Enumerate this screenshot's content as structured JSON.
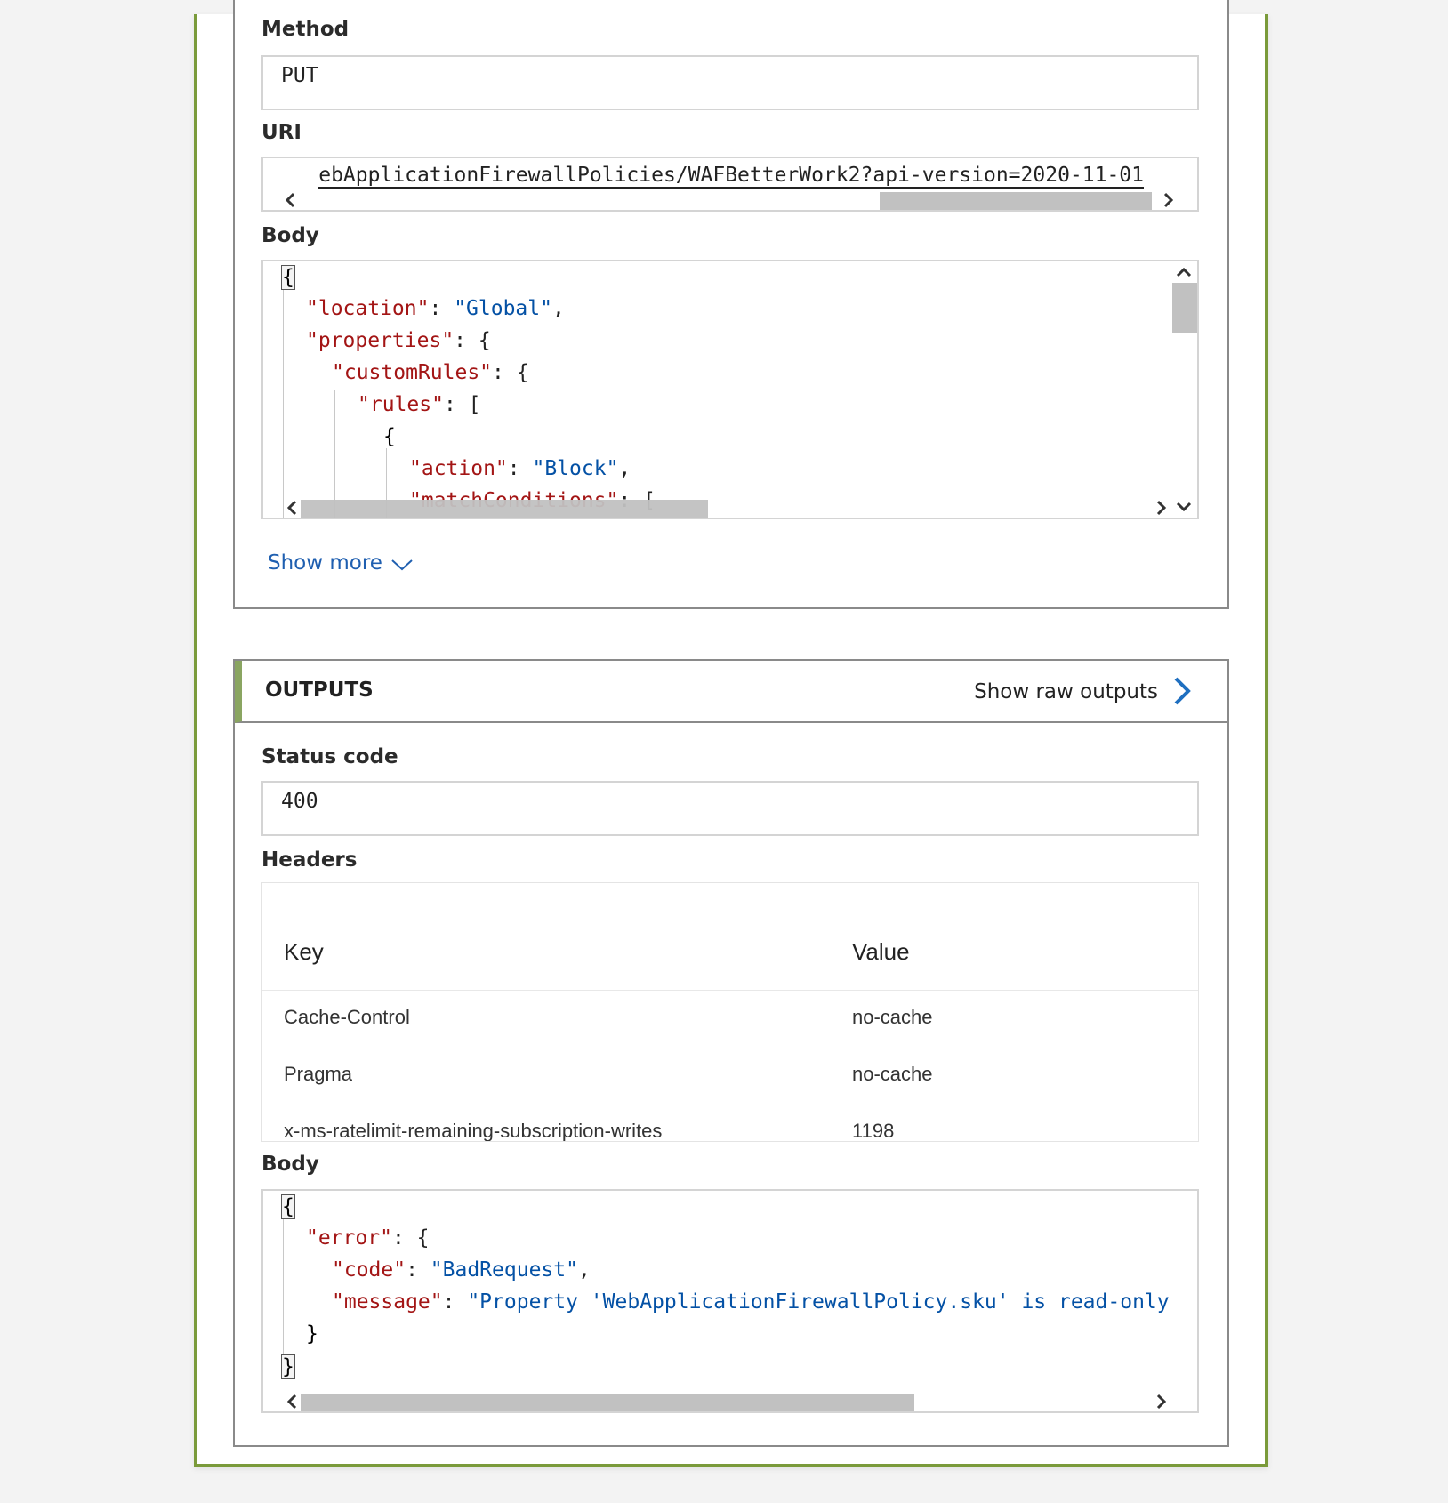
{
  "inputs": {
    "method": {
      "label": "Method",
      "value": "PUT"
    },
    "uri": {
      "label": "URI",
      "value": "ebApplicationFirewallPolicies/WAFBetterWork2?api-version=2020-11-01"
    },
    "body": {
      "label": "Body",
      "lines": [
        {
          "k": "",
          "v": "{"
        },
        {
          "k": "\"location\"",
          "sep": ": ",
          "v": "\"Global\"",
          "end": ","
        },
        {
          "k": "\"properties\"",
          "sep": ": ",
          "v": "",
          "end": "{"
        },
        {
          "k": "\"customRules\"",
          "sep": ": ",
          "v": "",
          "end": "{"
        },
        {
          "k": "\"rules\"",
          "sep": ": ",
          "v": "",
          "end": "["
        },
        {
          "k": "",
          "v": "{"
        },
        {
          "k": "\"action\"",
          "sep": ": ",
          "v": "\"Block\"",
          "end": ","
        },
        {
          "k": "\"matchConditions\"",
          "sep": ": ",
          "v": "",
          "end": "["
        }
      ]
    },
    "show_more": "Show more"
  },
  "outputs": {
    "title": "OUTPUTS",
    "show_raw": "Show raw outputs",
    "status": {
      "label": "Status code",
      "value": "400"
    },
    "headers": {
      "label": "Headers",
      "col_key": "Key",
      "col_value": "Value",
      "rows": [
        {
          "key": "Cache-Control",
          "value": "no-cache"
        },
        {
          "key": "Pragma",
          "value": "no-cache"
        },
        {
          "key": "x-ms-ratelimit-remaining-subscription-writes",
          "value": "1198"
        }
      ]
    },
    "body": {
      "label": "Body",
      "open": "{",
      "error_key": "\"error\"",
      "code_key": "\"code\"",
      "code_val": "\"BadRequest\"",
      "message_key": "\"message\"",
      "message_val": "\"Property 'WebApplicationFirewallPolicy.sku' is read-only",
      "inner_close": "}",
      "close": "}"
    }
  }
}
